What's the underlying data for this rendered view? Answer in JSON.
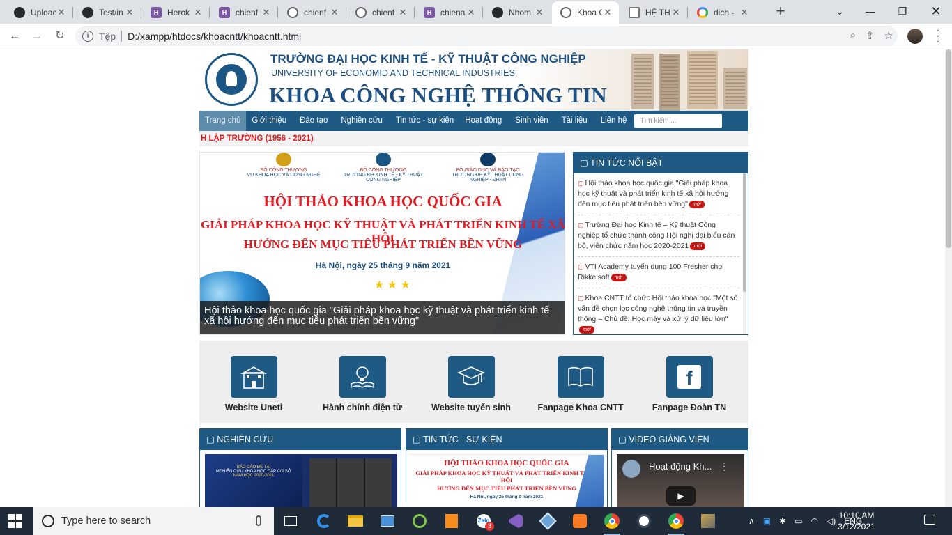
{
  "browser": {
    "tabs": [
      {
        "title": "Uploac",
        "favicon": "github-icon",
        "active": false
      },
      {
        "title": "Test/in",
        "favicon": "github-icon",
        "active": false
      },
      {
        "title": "Herok",
        "favicon": "heroku-icon",
        "active": false
      },
      {
        "title": "chienf",
        "favicon": "heroku-icon",
        "active": false
      },
      {
        "title": "chienf",
        "favicon": "globe-icon",
        "active": false
      },
      {
        "title": "chienf",
        "favicon": "globe-icon",
        "active": false
      },
      {
        "title": "chiena",
        "favicon": "heroku-icon",
        "active": false
      },
      {
        "title": "Nhom",
        "favicon": "github-icon",
        "active": false
      },
      {
        "title": "Khoa C",
        "favicon": "globe-icon",
        "active": true
      },
      {
        "title": "HỆ TH",
        "favicon": "document-icon",
        "active": false
      },
      {
        "title": "dich -",
        "favicon": "google-icon",
        "active": false
      }
    ],
    "url_label": "Tệp",
    "url": "D:/xampp/htdocs/khoacntt/khoacntt.html"
  },
  "page": {
    "header": {
      "university_vn": "TRƯỜNG ĐẠI HỌC KINH TẾ - KỸ THUẬT CÔNG NGHIỆP",
      "university_en": "UNIVERSITY OF ECONOMID AND TECHNICAL INDUSTRIES",
      "faculty": "KHOA CÔNG NGHỆ THÔNG TIN"
    },
    "nav": {
      "items": [
        {
          "label": "Trang chủ",
          "dropdown": false
        },
        {
          "label": "Giới thiệu",
          "dropdown": true
        },
        {
          "label": "Đào tạo",
          "dropdown": true
        },
        {
          "label": "Nghiên cứu",
          "dropdown": true
        },
        {
          "label": "Tin tức - sự kiện",
          "dropdown": false
        },
        {
          "label": "Hoạt động",
          "dropdown": true
        },
        {
          "label": "Sinh viên",
          "dropdown": true
        },
        {
          "label": "Tài liệu",
          "dropdown": true
        },
        {
          "label": "Liên hệ",
          "dropdown": false
        }
      ],
      "caret": "",
      "search_placeholder": "Tìm kiếm ..."
    },
    "marquee": "H LẬP TRƯỜNG (1956 - 2021)",
    "hero": {
      "ministries": [
        {
          "org": "BỘ CÔNG THƯƠNG",
          "sub": "VỤ KHOA HỌC VÀ CÔNG NGHỆ"
        },
        {
          "org": "BỘ CÔNG THƯƠNG",
          "sub": "TRƯỜNG ĐH KINH TẾ - KỸ THUẬT CÔNG NGHIỆP"
        },
        {
          "org": "BỘ GIÁO DỤC VÀ ĐÀO TẠO",
          "sub": "TRƯỜNG ĐH KỸ THUẬT CÔNG NGHIỆP - ĐHTN"
        }
      ],
      "headline": "HỘI THẢO KHOA HỌC QUỐC GIA",
      "subheadline_1": "GIẢI PHÁP KHOA HỌC KỸ THUẬT VÀ PHÁT TRIỂN KINH TẾ XÃ HỘI",
      "subheadline_2": "HƯỚNG ĐẾN MỤC TIÊU PHÁT TRIỂN BỀN VỮNG",
      "date": "Hà Nội, ngày 25 tháng 9 năm 2021",
      "caption": "Hội thảo khoa học quốc gia \"Giải pháp khoa học kỹ thuật và phát triển kinh tế xã hội hướng đến mục tiêu phát triển bền vững\""
    },
    "featured": {
      "title": "TIN TỨC NỔI BẬT",
      "badge": "mới",
      "items": [
        "Hội thảo khoa học quốc gia \"Giải pháp khoa học kỹ thuật và phát triển kinh tế xã hội hướng đến mục tiêu phát triển bền vững\"",
        "Trường Đại học Kinh tế – Kỹ thuật Công nghiệp tổ chức thành công Hội nghị đại biểu cán bộ, viên chức năm học 2020-2021",
        "VTI Academy tuyển dụng 100 Fresher cho Rikkeisoft",
        "Khoa CNTT tổ chức Hội thảo khoa học \"Một số vấn đề chọn lọc công nghệ thông tin và truyền thông – Chủ đề: Học máy và xử lý dữ liệu lớn\""
      ]
    },
    "quick_links": [
      {
        "label": "Website Uneti",
        "icon": "school-building-icon"
      },
      {
        "label": "Hành chính điện tử",
        "icon": "lightbulb-book-icon"
      },
      {
        "label": "Website tuyển sinh",
        "icon": "graduation-cap-icon"
      },
      {
        "label": "Fanpage Khoa CNTT",
        "icon": "open-book-icon"
      },
      {
        "label": "Fanpage Đoàn TN",
        "icon": "facebook-icon"
      }
    ],
    "sections": {
      "research": "NGHIÊN CỨU",
      "news": "TIN TỨC - SỰ KIỆN",
      "video": "VIDEO GIẢNG VIÊN",
      "video_title": "Hoạt động Kh...",
      "research_thumb_title": "BÁO CÁO ĐỀ TÀI",
      "research_thumb_sub": "NGHIÊN CỨU KHOA HỌC CẤP CƠ SỞ",
      "research_thumb_year": "NĂM HỌC 2020-2021",
      "news_thumb_1": "HỘI THẢO KHOA HỌC QUỐC GIA",
      "news_thumb_2": "GIẢI PHÁP KHOA HỌC KỸ THUẬT VÀ PHÁT TRIỂN KINH TẾ XÃ HỘI",
      "news_thumb_3": "HƯỚNG ĐẾN MỤC TIÊU PHÁT TRIỂN BỀN VỮNG",
      "news_thumb_4": "Hà Nội, ngày 25 tháng 9 năm 2021"
    }
  },
  "taskbar": {
    "search_placeholder": "Type here to search",
    "language": "ENG",
    "time": "10:10 AM",
    "date": "3/12/2021",
    "zalo_badge": "3"
  }
}
